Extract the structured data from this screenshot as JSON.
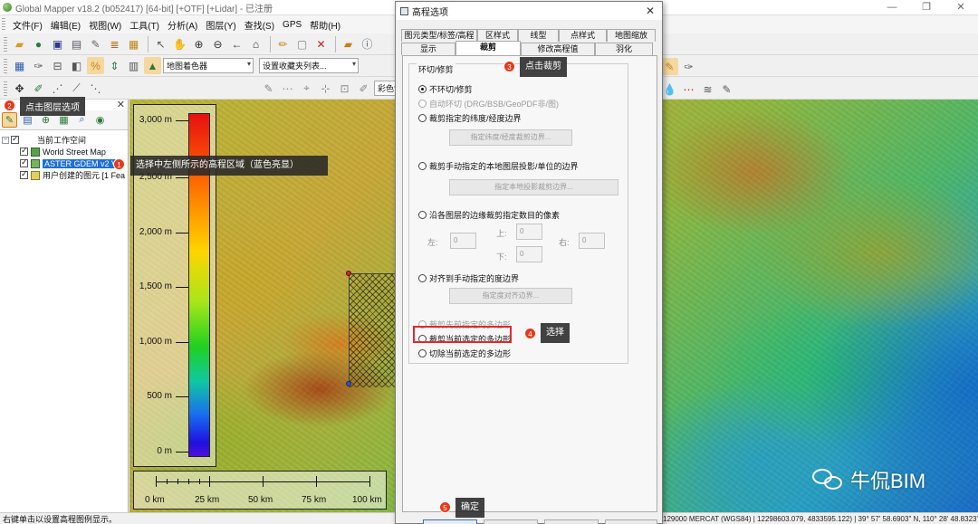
{
  "window": {
    "title": "Global Mapper v18.2 (b052417) [64-bit] [+OTF] [+Lidar] - 已注册",
    "controls": [
      "—",
      "❐",
      "✕"
    ]
  },
  "menu": [
    "文件(F)",
    "编辑(E)",
    "视图(W)",
    "工具(T)",
    "分析(A)",
    "图层(Y)",
    "查找(S)",
    "GPS",
    "帮助(H)"
  ],
  "toolbar2": {
    "shader_select": "地图着色器",
    "fav_select": "设置收藏夹列表..."
  },
  "toolbar3": {
    "color_select": "彩色雷达 按RGB/Elev"
  },
  "layer_panel": {
    "root": "当前工作空间",
    "layers": [
      {
        "label": "World Street Map"
      },
      {
        "label": "ASTER GDEM v2 V"
      },
      {
        "label": "用户创建的图元 [1 Fea"
      }
    ]
  },
  "legend": {
    "labels": [
      "3,000 m",
      "2,500 m",
      "2,000 m",
      "1,500 m",
      "1,000 m",
      "500 m",
      "0 m"
    ]
  },
  "scalebar": {
    "labels": [
      "0 km",
      "25 km",
      "50 km",
      "75 km",
      "100 km"
    ]
  },
  "dialog": {
    "title": "高程选项",
    "tabs_row1": [
      "图元类型/标签/高程",
      "区样式",
      "线型",
      "点样式",
      "地图缩放"
    ],
    "tabs_row2": [
      "显示",
      "裁剪",
      "修改高程值",
      "羽化"
    ],
    "active_tab": "裁剪",
    "group_title": "环切/修剪",
    "options": {
      "no_crop": "不环切/修剪",
      "auto_crop": "自动环切 (DRG/BSB/GeoPDF非/图)",
      "crop_latlon": "裁剪指定的纬度/经度边界",
      "btn_latlon": "指定纬度/经度裁剪边界...",
      "crop_native": "裁剪手动指定的本地图层投影/单位的边界",
      "btn_native": "指定本地投影裁剪边界...",
      "crop_pixels": "沿各图层的边缘裁剪指定数目的像素",
      "left": "左:",
      "top": "上:",
      "right": "右:",
      "bottom": "下:",
      "pixel_value": "0",
      "snap_degree": "对齐到手动指定的度边界",
      "btn_degree": "指定度对齐边界...",
      "crop_prev_poly": "裁剪先前指定的多边形",
      "crop_selected_poly": "裁剪当前选定的多边形",
      "cut_selected_poly": "切除当前选定的多边形"
    }
  },
  "annotations": {
    "n1": "1",
    "a1": "选择中左侧所示的高程区域（蓝色亮显）",
    "n2": "2",
    "a2": "点击图层选项",
    "n3": "3",
    "a3": "点击裁剪",
    "n4": "4",
    "a4": "选择",
    "n5": "5",
    "a5": "确定"
  },
  "status": {
    "left": "右键单击以设置高程图例显示。",
    "right": "129000  MERCAT (WGS84) | 12298603.079, 4833595.122) | 39° 57' 58.6903\" N, 110° 28' 48.8323\" E"
  },
  "watermark": "牛侃BIM",
  "colors": {
    "accent": "#1e6fd9",
    "annotation_red": "#e8381a",
    "highlight_box": "#e02a2a"
  }
}
